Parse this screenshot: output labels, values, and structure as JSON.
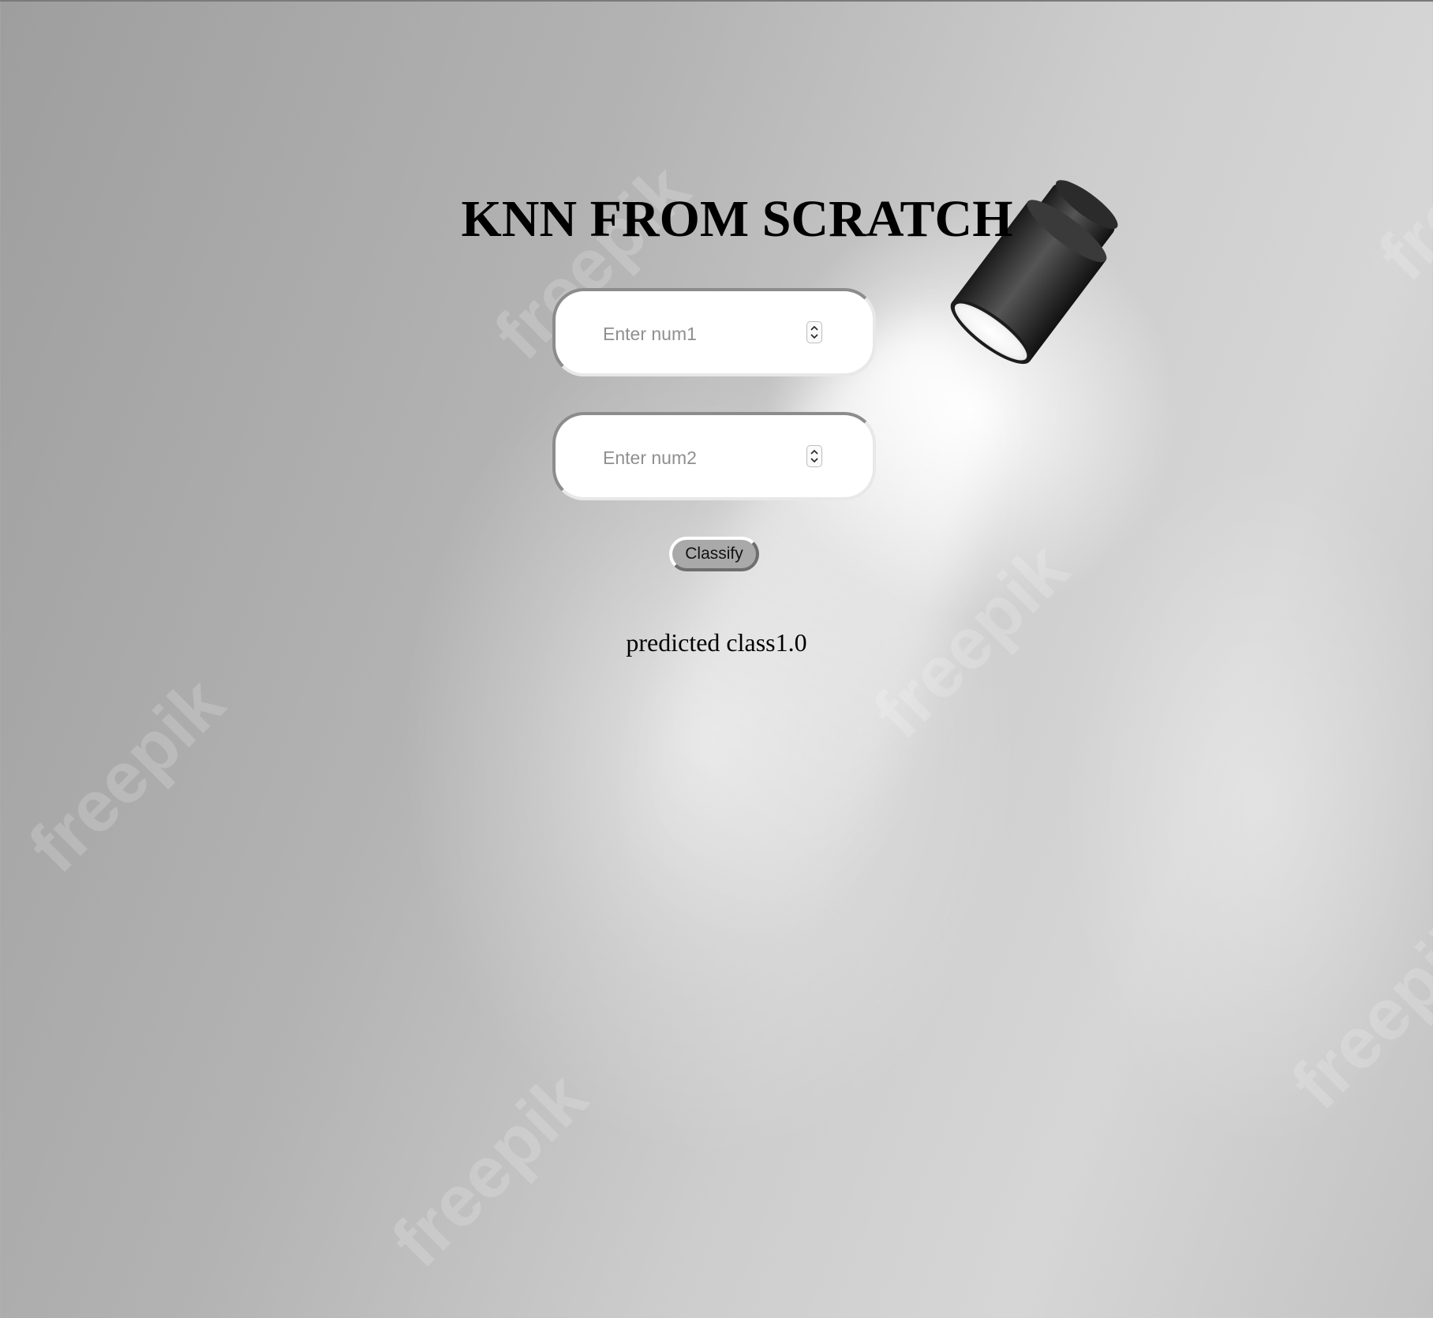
{
  "page": {
    "title": "KNN FROM SCRATCH"
  },
  "form": {
    "num1": {
      "placeholder": "Enter num1",
      "value": ""
    },
    "num2": {
      "placeholder": "Enter num2",
      "value": ""
    },
    "classify_label": "Classify"
  },
  "result": {
    "text": "predicted class1.0"
  },
  "background": {
    "watermark_text": "freepik",
    "decoration": "spotlight-lamp"
  },
  "colors": {
    "text": "#000000",
    "field_bg": "#ffffff",
    "button_bg": "#a9a9a9"
  },
  "icons": [
    "spotlight-lamp-icon",
    "spinner-arrows-icon"
  ]
}
